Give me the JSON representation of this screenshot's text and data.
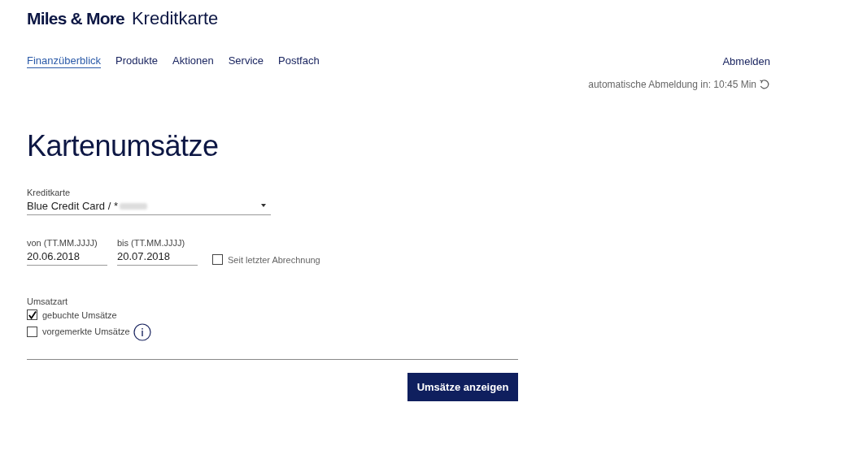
{
  "brand": {
    "name": "Miles & More",
    "product": "Kreditkarte"
  },
  "nav": [
    {
      "label": "Finanzüberblick",
      "selected": true
    },
    {
      "label": "Produkte",
      "selected": false
    },
    {
      "label": "Aktionen",
      "selected": false
    },
    {
      "label": "Service",
      "selected": false
    },
    {
      "label": "Postfach",
      "selected": false
    }
  ],
  "logout": {
    "label": "Abmelden",
    "timer": "automatische Abmeldung in: 10:45 Min"
  },
  "heading": "Kartenumsätze",
  "card_select": {
    "label": "Kreditkarte",
    "value": "Blue Credit Card / *"
  },
  "date_from": {
    "label": "von (TT.MM.JJJJ)",
    "value": "20.06.2018"
  },
  "date_to": {
    "label": "bis (TT.MM.JJJJ)",
    "value": "20.07.2018"
  },
  "since_last_statement": {
    "label": "Seit letzter Abrechnung",
    "checked": false
  },
  "transaction_type": {
    "label": "Umsatzart",
    "options": [
      {
        "label": "gebuchte Umsätze",
        "checked": true,
        "info": false
      },
      {
        "label": "vorgemerkte Umsätze",
        "checked": false,
        "info": true
      }
    ]
  },
  "submit": "Umsätze anzeigen"
}
